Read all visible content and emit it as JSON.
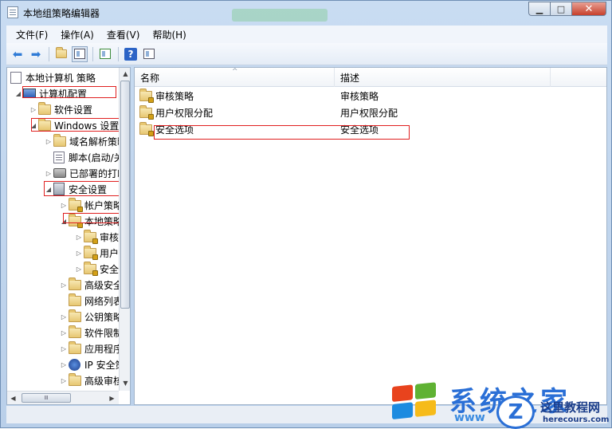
{
  "window": {
    "title": "本地组策略编辑器",
    "controls": {
      "minimize": "▁",
      "maximize": "□",
      "close": "✕"
    }
  },
  "menu": [
    "文件(F)",
    "操作(A)",
    "查看(V)",
    "帮助(H)"
  ],
  "toolbar": {
    "icons": [
      "back-arrow-icon",
      "forward-arrow-icon",
      "up-folder-icon",
      "show-hide-tree-icon",
      "export-list-icon",
      "help-icon",
      "properties-icon"
    ]
  },
  "tree": {
    "root": "本地计算机 策略",
    "items": [
      {
        "label": "计算机配置",
        "arrow": "◢",
        "icon": "computer-icon"
      },
      {
        "label": "软件设置",
        "arrow": "▷",
        "icon": "folder-icon"
      },
      {
        "label": "Windows 设置",
        "arrow": "◢",
        "icon": "folder-icon"
      },
      {
        "label": "域名解析策略",
        "arrow": "▷",
        "icon": "folder-icon"
      },
      {
        "label": "脚本(启动/关机)",
        "arrow": "",
        "icon": "script-icon"
      },
      {
        "label": "已部署的打印机",
        "arrow": "▷",
        "icon": "printer-icon"
      },
      {
        "label": "安全设置",
        "arrow": "◢",
        "icon": "security-settings-icon"
      },
      {
        "label": "帐户策略",
        "arrow": "▷",
        "icon": "folder-lock-icon"
      },
      {
        "label": "本地策略",
        "arrow": "◢",
        "icon": "folder-lock-icon"
      },
      {
        "label": "审核策略",
        "arrow": "▷",
        "icon": "folder-lock-icon"
      },
      {
        "label": "用户权限分配",
        "arrow": "▷",
        "icon": "folder-lock-icon"
      },
      {
        "label": "安全选项",
        "arrow": "▷",
        "icon": "folder-lock-icon"
      },
      {
        "label": "高级安全 Windows 防火墙",
        "arrow": "▷",
        "icon": "folder-icon"
      },
      {
        "label": "网络列表管理器策略",
        "arrow": "",
        "icon": "folder-icon"
      },
      {
        "label": "公钥策略",
        "arrow": "▷",
        "icon": "folder-icon"
      },
      {
        "label": "软件限制策略",
        "arrow": "▷",
        "icon": "folder-icon"
      },
      {
        "label": "应用程序控制策略",
        "arrow": "▷",
        "icon": "folder-icon"
      },
      {
        "label": "IP 安全策略",
        "arrow": "▷",
        "icon": "ip-security-icon"
      },
      {
        "label": "高级审核策略配置",
        "arrow": "▷",
        "icon": "folder-icon"
      }
    ],
    "hscroll_grip": "Ⅲ"
  },
  "list": {
    "columns": {
      "name": "名称",
      "description": "描述"
    },
    "sort_caret": "^",
    "rows": [
      {
        "name": "审核策略",
        "description": "审核策略"
      },
      {
        "name": "用户权限分配",
        "description": "用户权限分配"
      },
      {
        "name": "安全选项",
        "description": "安全选项"
      }
    ]
  },
  "watermark": {
    "big_text": "系统之家",
    "url": "www",
    "badge": "Z",
    "site": "这里教程网",
    "domain": "herecours.com"
  },
  "colors": {
    "annotation_red": "#e02020",
    "accent_blue": "#2a6fd6"
  }
}
